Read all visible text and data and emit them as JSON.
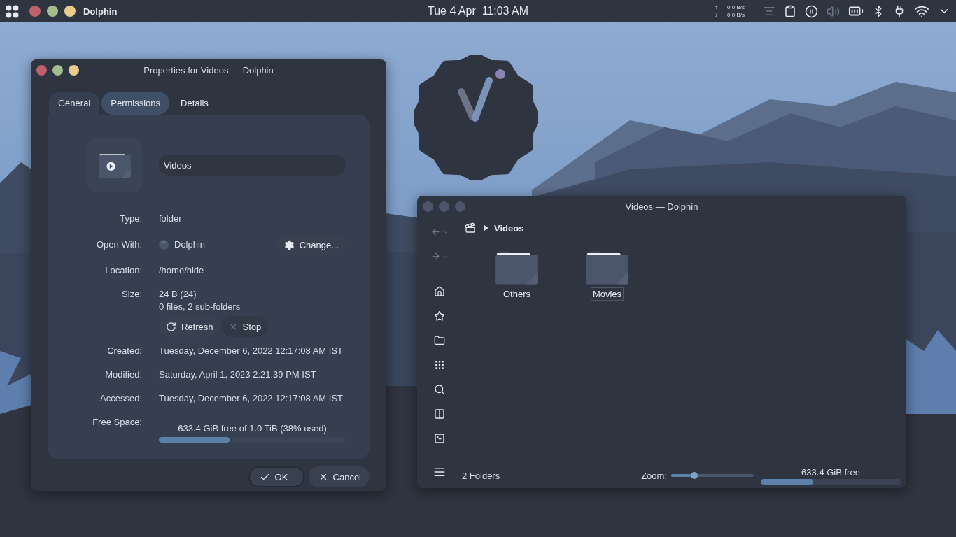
{
  "top_bar": {
    "app_name": "Dolphin",
    "clock": "Tue 4 Apr  11:03 AM",
    "network": [
      {
        "arrow": "↑",
        "rate": "0.0 B/s"
      },
      {
        "arrow": "↓",
        "rate": "0.0 B/s"
      }
    ]
  },
  "properties_dialog": {
    "title": "Properties for Videos — Dolphin",
    "active": true,
    "tabs": [
      {
        "label": "General",
        "selected": true,
        "hovered": false
      },
      {
        "label": "Permissions",
        "selected": false,
        "hovered": true
      },
      {
        "label": "Details",
        "selected": false,
        "hovered": false
      }
    ],
    "name": "Videos",
    "rows": [
      {
        "kind": "text",
        "label": "Type:",
        "value": "folder"
      },
      {
        "kind": "app",
        "label": "Open With:",
        "value": "Dolphin",
        "button": "Change..."
      },
      {
        "kind": "text",
        "label": "Location:",
        "value": "/home/hide"
      },
      {
        "kind": "size",
        "label": "Size:",
        "value": "24 B (24)",
        "detail": "0 files, 2 sub-folders",
        "buttons": [
          {
            "kind": "refresh",
            "label": "Refresh",
            "disabled": false
          },
          {
            "kind": "stop",
            "label": "Stop",
            "disabled": true
          }
        ]
      },
      {
        "kind": "date",
        "label": "Created:",
        "value": "Tuesday, December 6, 2022 12:17:08 AM IST"
      },
      {
        "kind": "date",
        "label": "Modified:",
        "value": "Saturday, April 1, 2023 2:21:39 PM IST"
      },
      {
        "kind": "date",
        "label": "Accessed:",
        "value": "Tuesday, December 6, 2022 12:17:08 AM IST"
      },
      {
        "kind": "meter",
        "label": "Free Space:",
        "value": "633.4 GiB free of 1.0 TiB (38% used)",
        "level": 0.38
      }
    ],
    "buttons": [
      {
        "kind": "ok",
        "label": "OK",
        "default": true
      },
      {
        "kind": "cancel",
        "label": "Cancel",
        "default": false
      }
    ]
  },
  "dolphin_window": {
    "title": "Videos — Dolphin",
    "active": false,
    "breadcrumb": "Videos",
    "items": [
      {
        "name": "Others",
        "focused": false
      },
      {
        "name": "Movies",
        "focused": true
      }
    ],
    "status": "2 Folders",
    "zoom_label": "Zoom:",
    "zoom_slider": {
      "level": 0.28
    },
    "free_space": {
      "text": "633.4 GiB free",
      "level": 0.375
    }
  }
}
